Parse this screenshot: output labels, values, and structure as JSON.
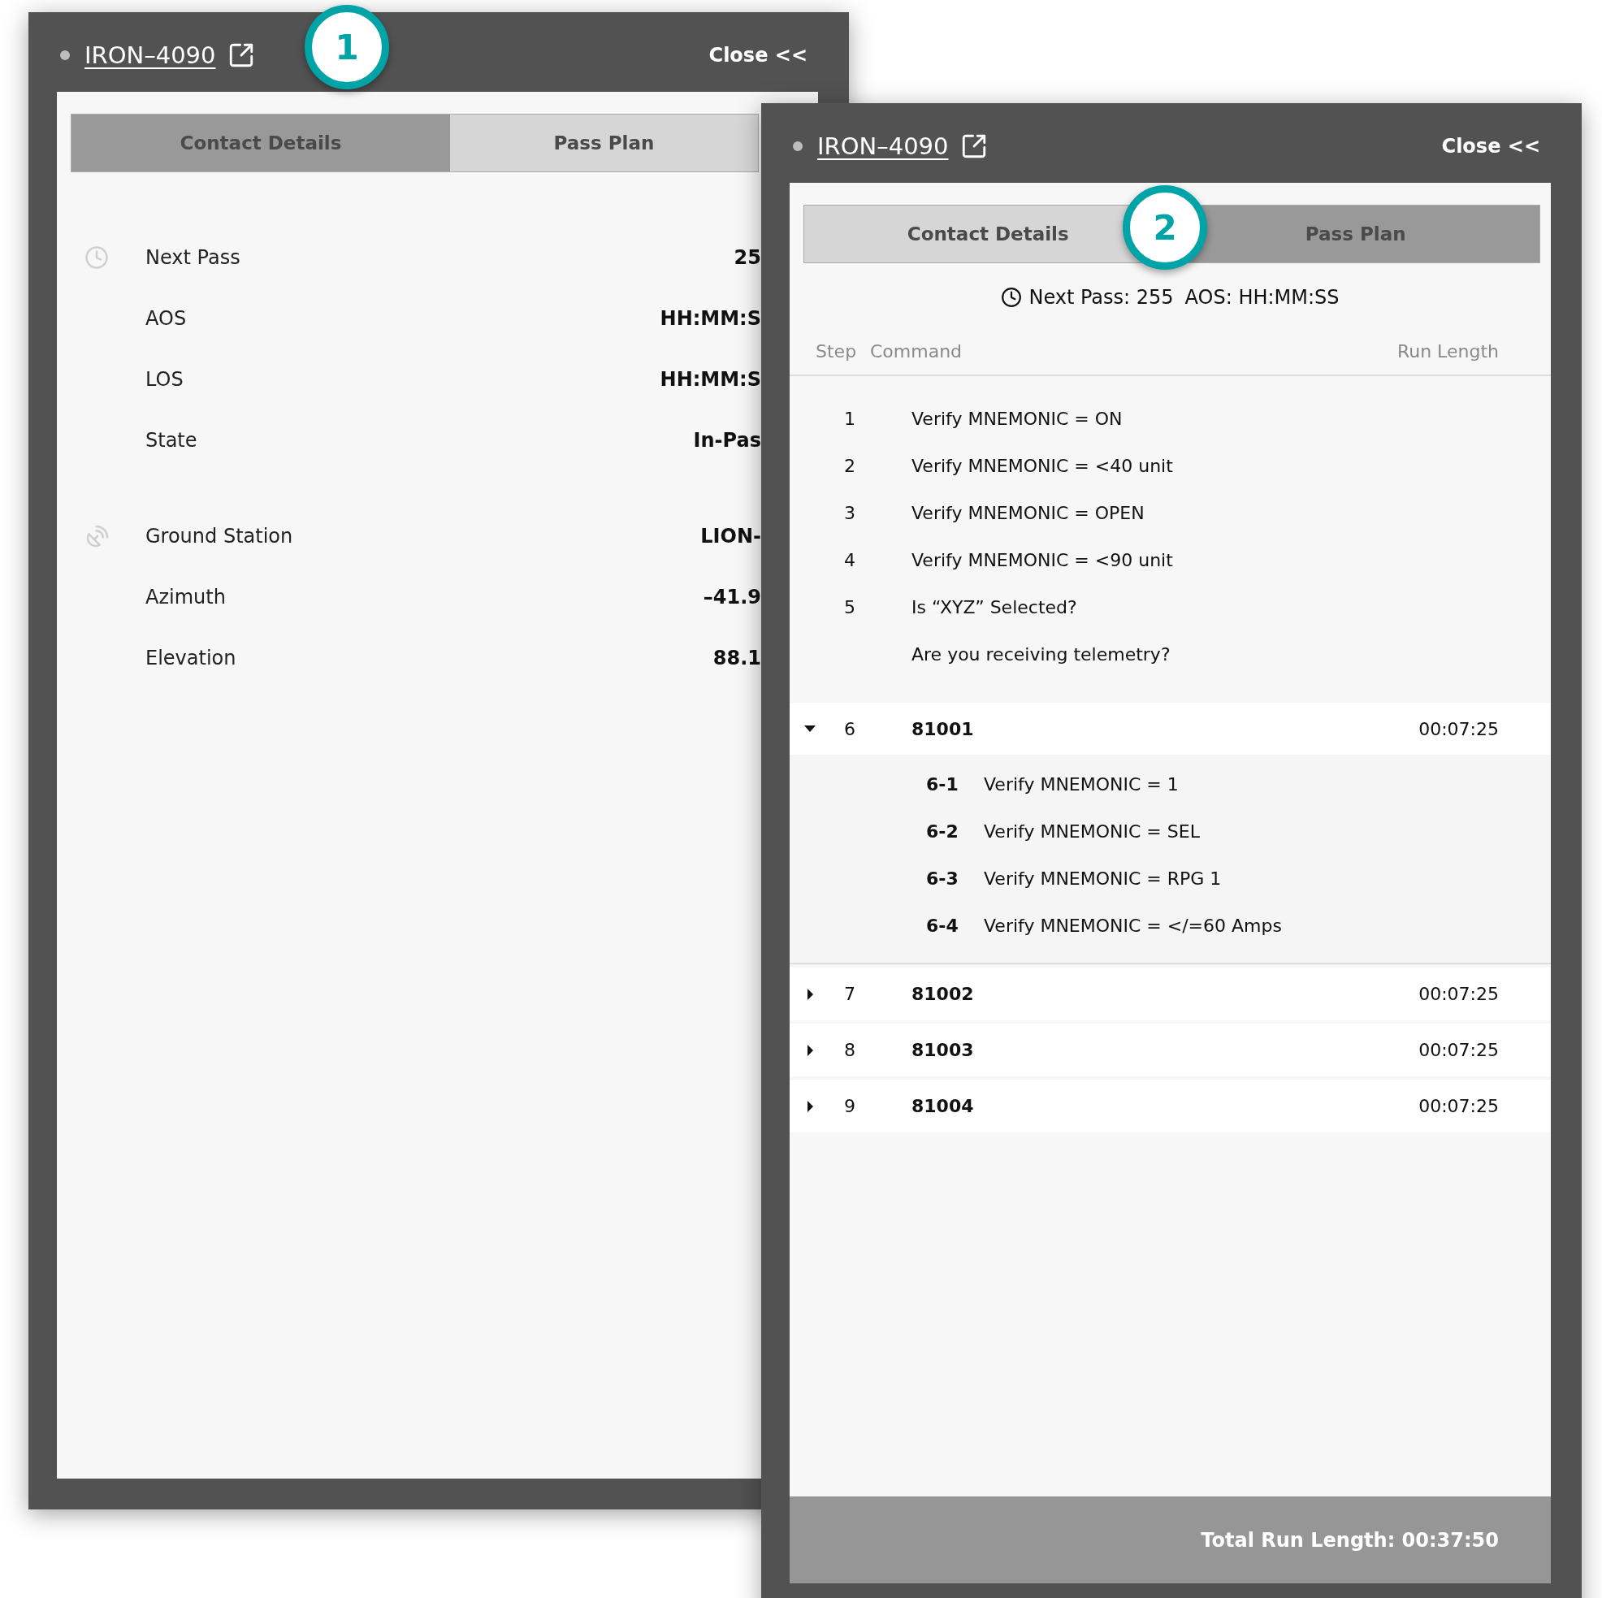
{
  "panels": [
    {
      "title": "IRON–4090",
      "close": "Close <<",
      "badge": "1",
      "kind": "details",
      "tabs": [
        {
          "label": "Contact Details",
          "selected": true
        },
        {
          "label": "Pass Plan",
          "selected": false
        }
      ],
      "groups": [
        {
          "kind": "pass",
          "rows": [
            {
              "label": "Next Pass",
              "value": "25"
            },
            {
              "label": "AOS",
              "value": "HH:MM:S"
            },
            {
              "label": "LOS",
              "value": "HH:MM:S"
            },
            {
              "label": "State",
              "value": "In-Pas"
            }
          ]
        },
        {
          "kind": "station",
          "rows": [
            {
              "label": "Ground Station",
              "value": "LION-"
            },
            {
              "label": "Azimuth",
              "value": "–41.9"
            },
            {
              "label": "Elevation",
              "value": "88.1"
            }
          ]
        }
      ]
    },
    {
      "title": "IRON–4090",
      "close": "Close <<",
      "badge": "2",
      "kind": "plan",
      "tabs": [
        {
          "label": "Contact Details",
          "selected": false
        },
        {
          "label": "Pass Plan",
          "selected": true
        }
      ],
      "summary": [
        "Next Pass: 255",
        "AOS: HH:MM:SS"
      ],
      "columns": [
        "Step",
        "Command",
        "Run Length"
      ],
      "steps": [
        {
          "kind": "command",
          "step": "1",
          "command": "Verify MNEMONIC = ON"
        },
        {
          "kind": "command",
          "step": "2",
          "command": "Verify MNEMONIC = <40 unit"
        },
        {
          "kind": "command",
          "step": "3",
          "command": "Verify MNEMONIC = OPEN"
        },
        {
          "kind": "command",
          "step": "4",
          "command": "Verify MNEMONIC = <90 unit"
        },
        {
          "kind": "command",
          "step": "5",
          "command": "Is “XYZ” Selected?"
        },
        {
          "kind": "note",
          "command": "Are you receiving telemetry?"
        },
        {
          "kind": "group",
          "step": "6",
          "command": "81001",
          "run_length": "00:07:25",
          "expanded": true,
          "children": [
            {
              "step": "6-1",
              "command": "Verify MNEMONIC = 1"
            },
            {
              "step": "6-2",
              "command": "Verify MNEMONIC = SEL"
            },
            {
              "step": "6-3",
              "command": "Verify MNEMONIC = RPG 1"
            },
            {
              "step": "6-4",
              "command": "Verify MNEMONIC = </=60 Amps"
            }
          ]
        },
        {
          "kind": "group",
          "step": "7",
          "command": "81002",
          "run_length": "00:07:25",
          "expanded": false
        },
        {
          "kind": "group",
          "step": "8",
          "command": "81003",
          "run_length": "00:07:25",
          "expanded": false
        },
        {
          "kind": "group",
          "step": "9",
          "command": "81004",
          "run_length": "00:07:25",
          "expanded": false
        }
      ],
      "footer": "Total Run Length: 00:37:50"
    }
  ]
}
